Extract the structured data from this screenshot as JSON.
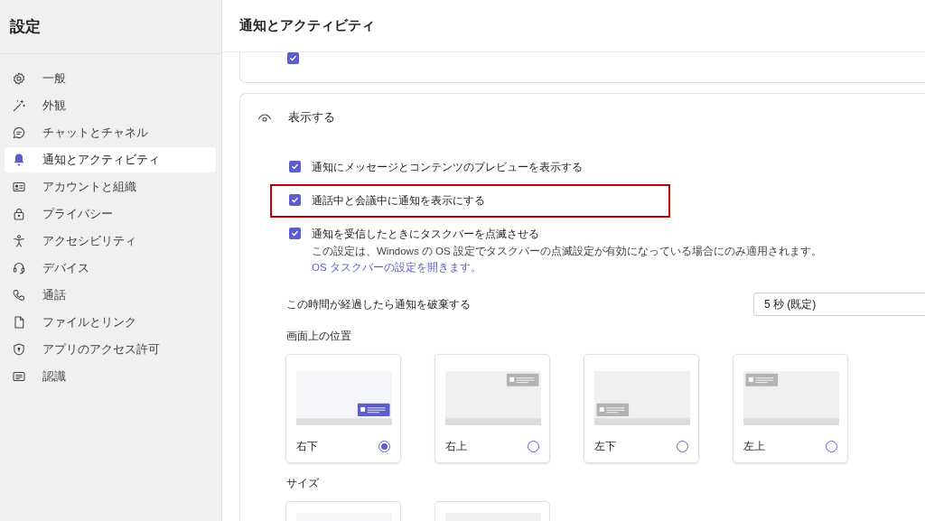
{
  "sidebar": {
    "title": "設定",
    "items": [
      {
        "label": "一般",
        "selected": false
      },
      {
        "label": "外観",
        "selected": false
      },
      {
        "label": "チャットとチャネル",
        "selected": false
      },
      {
        "label": "通知とアクティビティ",
        "selected": true
      },
      {
        "label": "アカウントと組織",
        "selected": false
      },
      {
        "label": "プライバシー",
        "selected": false
      },
      {
        "label": "アクセシビリティ",
        "selected": false
      },
      {
        "label": "デバイス",
        "selected": false
      },
      {
        "label": "通話",
        "selected": false
      },
      {
        "label": "ファイルとリンク",
        "selected": false
      },
      {
        "label": "アプリのアクセス許可",
        "selected": false
      },
      {
        "label": "認識",
        "selected": false
      }
    ]
  },
  "page_title": "通知とアクティビティ",
  "previous_card": {
    "checked": true
  },
  "display_section": {
    "title": "表示する",
    "options": [
      {
        "label": "通知にメッセージとコンテンツのプレビューを表示する",
        "checked": true,
        "highlighted": false
      },
      {
        "label": "通話中と会議中に通知を表示にする",
        "checked": true,
        "highlighted": true
      },
      {
        "label": "通知を受信したときにタスクバーを点滅させる",
        "checked": true,
        "highlighted": false,
        "description": "この設定は、Windows の OS 設定でタスクバーの点滅設定が有効になっている場合にのみ適用されます。",
        "link": "OS タスクバーの設定を開きます。"
      }
    ],
    "discard": {
      "label": "この時間が経過したら通知を破棄する",
      "value": "5 秒 (既定)"
    },
    "position_title": "画面上の位置",
    "positions": [
      {
        "label": "右下",
        "selected": true
      },
      {
        "label": "右上",
        "selected": false
      },
      {
        "label": "左下",
        "selected": false
      },
      {
        "label": "左上",
        "selected": false
      }
    ],
    "size_title": "サイズ",
    "sizes": [
      {
        "kind": "filled"
      },
      {
        "kind": "plain"
      }
    ]
  }
}
